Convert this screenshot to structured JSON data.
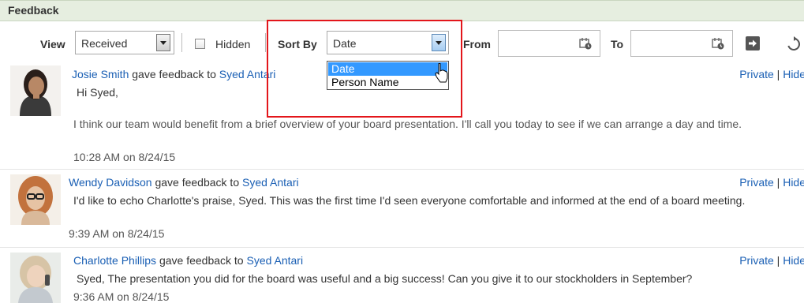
{
  "panel": {
    "title": "Feedback"
  },
  "toolbar": {
    "view_label": "View",
    "view_value": "Received",
    "hidden_label": "Hidden",
    "sortby_label": "Sort By",
    "sortby_value": "Date",
    "from_label": "From",
    "to_label": "To"
  },
  "sort_dropdown": {
    "options": [
      "Date",
      "Person Name"
    ],
    "selected": "Date"
  },
  "feedback": [
    {
      "author": "Josie Smith",
      "verb": "gave feedback to",
      "recipient": "Syed Antari",
      "greeting": "Hi Syed,",
      "message": "I think our team would benefit from a brief overview of your board presentation. I'll call you today to see if we can arrange a day and time.",
      "timestamp": "10:28 AM on 8/24/15",
      "private_label": "Private",
      "hide_label": "Hide"
    },
    {
      "author": "Wendy Davidson",
      "verb": "gave feedback to",
      "recipient": "Syed Antari",
      "message": "I'd like to echo Charlotte's praise, Syed. This was the first time I'd seen everyone comfortable and informed at the end of a board meeting.",
      "timestamp": "9:39 AM on 8/24/15",
      "private_label": "Private",
      "hide_label": "Hide"
    },
    {
      "author": "Charlotte Phillips",
      "verb": "gave feedback to",
      "recipient": "Syed Antari",
      "message": "Syed, The presentation you did for the board was useful and a big success! Can you give it to our stockholders in September?",
      "timestamp": "9:36 AM on 8/24/15",
      "private_label": "Private",
      "hide_label": "Hide"
    }
  ],
  "icons": {
    "view_dropdown": "chevron-down-icon",
    "sort_dropdown": "chevron-down-icon",
    "from_calendar": "calendar-icon",
    "to_calendar": "calendar-icon",
    "go": "arrow-right-icon",
    "refresh": "refresh-icon",
    "cursor": "mouse-pointer-icon"
  },
  "colors": {
    "link": "#1a5fb4",
    "highlight_box": "#e3161b",
    "selected_option": "#3399ff",
    "header_bg": "#e6eee0"
  }
}
